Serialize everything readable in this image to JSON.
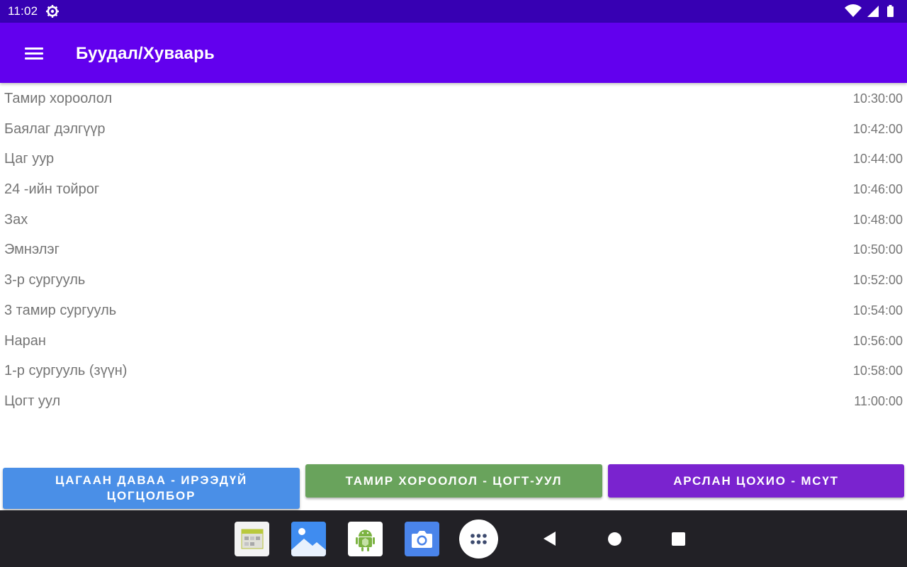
{
  "status_bar": {
    "time": "11:02",
    "icons": [
      "settings-gear-icon",
      "wifi-icon",
      "signal-icon",
      "battery-icon"
    ]
  },
  "app_bar": {
    "title": "Буудал/Хуваарь",
    "menu_icon": "hamburger-menu-icon"
  },
  "stops": [
    {
      "name": "Тамир хороолол",
      "time": "10:30:00"
    },
    {
      "name": "Баялаг дэлгүүр",
      "time": "10:42:00"
    },
    {
      "name": "Цаг уур",
      "time": "10:44:00"
    },
    {
      "name": "24 -ийн тойрог",
      "time": "10:46:00"
    },
    {
      "name": "Зах",
      "time": "10:48:00"
    },
    {
      "name": "Эмнэлэг",
      "time": "10:50:00"
    },
    {
      "name": "3-р сургууль",
      "time": "10:52:00"
    },
    {
      "name": "3 тамир сургууль",
      "time": "10:54:00"
    },
    {
      "name": "Наран",
      "time": "10:56:00"
    },
    {
      "name": "1-р сургууль (зүүн)",
      "time": "10:58:00"
    },
    {
      "name": "Цогт уул",
      "time": "11:00:00"
    }
  ],
  "route_buttons": [
    {
      "label": "ЦАГААН ДАВАА - ИРЭЭДҮЙ ЦОГЦОЛБОР",
      "color": "#4a8fe7"
    },
    {
      "label": "ТАМИР ХОРООЛОЛ - ЦОГТ-УУЛ",
      "color": "#69a35c"
    },
    {
      "label": "АРСЛАН ЦОХИО - МСҮТ",
      "color": "#7a23cf"
    }
  ],
  "nav_bar": {
    "dock_apps": [
      "calendar-app-icon",
      "gallery-app-icon",
      "android-app-icon",
      "camera-app-icon"
    ],
    "all_apps_icon": "all-apps-icon",
    "buttons": [
      "back-icon",
      "home-icon",
      "recents-icon"
    ]
  },
  "colors": {
    "status_bar": "#3700b3",
    "app_bar": "#6200ee",
    "text_gray": "#757575",
    "nav_bar": "#222126"
  }
}
